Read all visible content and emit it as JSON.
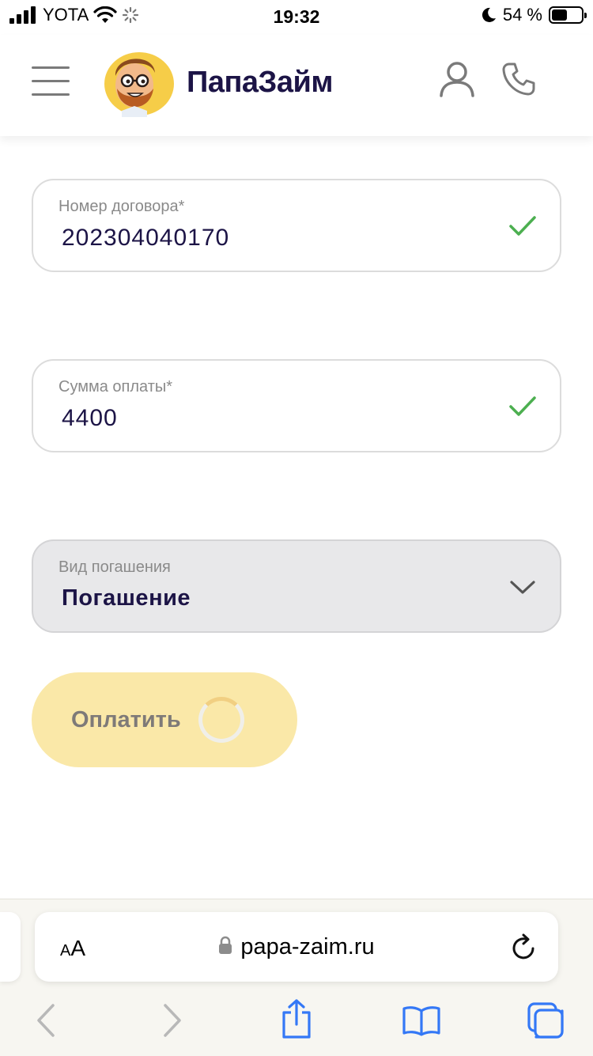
{
  "status_bar": {
    "carrier": "YOTA",
    "time": "19:32",
    "battery_percent": "54 %",
    "battery_level": 0.54
  },
  "header": {
    "brand": "ПапаЗайм",
    "icons": [
      "menu-icon",
      "user-icon",
      "phone-icon"
    ]
  },
  "form": {
    "contract": {
      "label": "Номер договора*",
      "value": "202304040170",
      "valid": true
    },
    "amount": {
      "label": "Сумма оплаты*",
      "value": "4400",
      "valid": true
    },
    "repayment_type": {
      "label": "Вид погашения",
      "value": "Погашение"
    },
    "submit": {
      "label": "Оплатить",
      "loading": true
    }
  },
  "browser": {
    "text_size_label": "AA",
    "url": "papa-zaim.ru"
  },
  "colors": {
    "brand_dark": "#1c1446",
    "check_green": "#4caf50",
    "button_yellow": "#fae8a8",
    "ios_blue": "#3478f6"
  }
}
